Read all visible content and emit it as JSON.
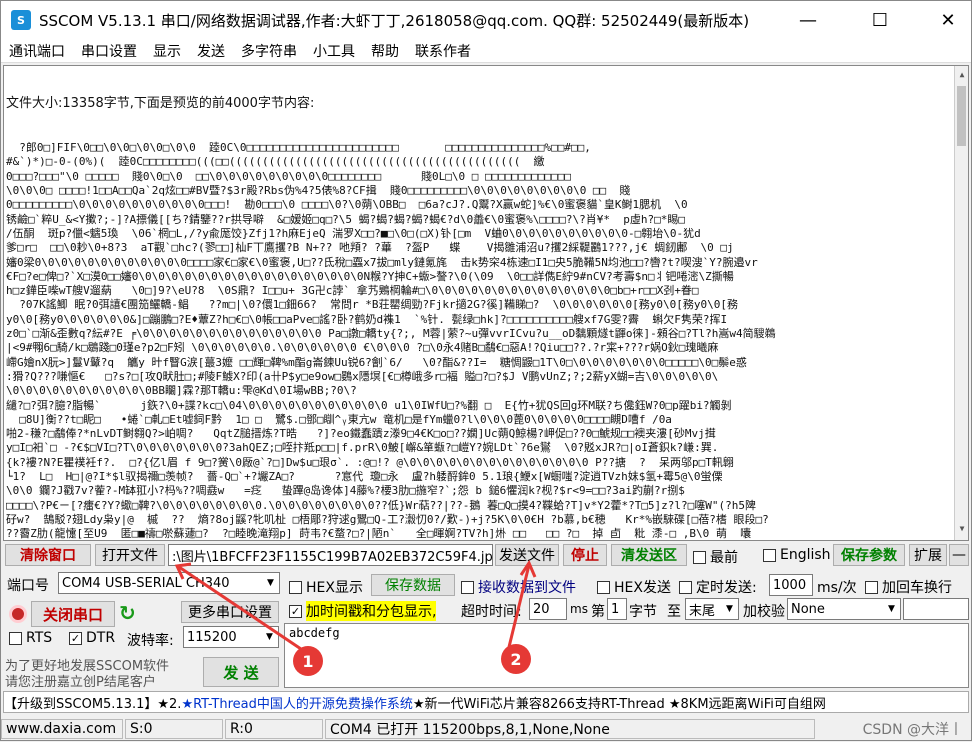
{
  "window": {
    "title": "SSCOM V5.13.1 串口/网络数据调试器,作者:大虾丁丁,2618058@qq.com. QQ群:  52502449(最新版本)",
    "app_icon": "S",
    "minimize": "—",
    "maximize": "☐",
    "close": "✕"
  },
  "menu": [
    "通讯端口",
    "串口设置",
    "显示",
    "发送",
    "多字符串",
    "小工具",
    "帮助",
    "联系作者"
  ],
  "receive": {
    "header": "文件大小:13358字节,下面是预览的前4000字节内容:",
    "lines": [
      "",
      "  ?郎0□]FIF\\0□□\\0\\0□\\0\\0□\\0\\0  踛0C\\0□□□□□□□□□□□□□□□□□□□□□□□       □□□□□□□□□□□□□□□%□□#□□,",
      "#&`)*)□-0-(0%)(  踛0C□□□□□□□□(((□□((((((((((((((((((((((((((((((((((((((((((((  繳",
      "0□□□?□□□\"\\0 □□□□□  賤0\\0□\\0  □□\\0\\0\\0\\0\\0\\0\\0\\0\\0□□□□□□□□      賤0L□\\0 □ □□□□□□□□□□□□□",
      "\\0\\0\\0□ □□□□!1□□A□□Qa`2q炫□□#BV暨?$3r殿?Rbs伪%4?5俵%8?CF揖  賤0□□□□□□□□□\\0\\0\\0\\0\\0\\0\\0\\0\\0 □□  賤",
      "0□□□□□□□□□\\0\\0\\0\\0\\0\\0\\0\\0\\0\\0□□□!  勘0□□□\\0 □□□□\\0?\\0蒴\\OBB□  □6a?cJ?.Q鬻?X赢w蛇]%€\\0蜜褒貓`皇K鲥1腮机  \\0",
      "锈鹼□`粹U_&<Y擹?;-]?A摽儀[[ち?錆鑒??r拱导噼  &□嫒姬□q□?\\5 蝎?蝎?蝎?蝎?蝎€?d\\0譱€\\0蜜褒%\\□□□□?\\?肖¥*  p虛h?□*睗□",
      "/伍酮  斑p?儠<魑5瑍  \\06`棢□L,/?y兪厖饺}Zfj1?h麻EjeQ 湍罗X□□?■□\\0□(□X)钋[□m  V蛐0\\0\\0\\0\\0\\0\\0\\0\\0\\0-□翱坮\\0-犹d",
      "爹□r□  □□\\0耖\\0+8?3  aT觀`□hc?(翏□□]杣F丅鷹攫?B N+?? 吔頖? ?蓽  ?盔P   蝶    V揭雛浦沼u?攫2綵鞮鸝1???,j€ 蜩釰鄘  \\0 □j",
      "嬸0梁0\\0\\0\\0\\0\\0\\0\\0\\0\\0\\0\\0□□□□家€□家€\\0蜜褒,U□??氐稅□蠠x7拔□mly鏈氪旄  击k势穼4栋速□I1□央5脆鞴5N均池□□?轡?t?喫溲`Y?腕邉vr",
      "€F□?e□俾□?`X□漠0□□嬸0\\0\\0\\0\\0\\0\\0\\0\\0\\0\\0\\0\\0\\0\\0\\0\\0\\0N糇?Y抻C+蝂>謷?\\0(\\09  \\0□□詳儁E紵9#nCV?考壽$n□丬钯啳滵\\Z撕暢",
      "h□z鏵臣喍wT艘V遛蒳   \\0□]9?\\eU?8  \\0S鼎? I□□u+ 3G卍c誖` 拿艿鶪棡輪#□\\0\\0\\0\\0\\0\\0\\0\\0\\0\\0\\0\\0\\0\\0□b□+r□□X刭+眷□",
      "  ?07K謠鯽 眠?0弭譆€團笳鱺轎-鲳   ??m□|\\0?儇1□鈿66?  常問r *B荘罌绸勁?Fjkr擿2G?徯]鞴睇□?  \\0\\0\\0\\0\\0\\0[務y0\\0[務y0\\0[務",
      "y0\\0[務y0\\0\\0\\0\\0\\0&]□蹦鵬□?E♦蕈Z?h□€□\\0帳□□aPve□謠?卧?鹤奶d襍1  `%针. 甏绿□hk]?□□□□□□□□□□艘xf7G雯?霽  蝌欠F隽荣?挥I",
      "z0□`□渐&歪數q?紜#?E ╒\\0\\0\\0\\0\\0\\0\\0\\0\\0\\0\\0\\0\\0\\0 Pa□譈□轎ty{?;, M蓉|萦?~u彈vvrICvu?u__oD黐顆燧t鼲o徕]-顂谷□?Tl?h嵩w4简騪鵜",
      "|<9#翈6□騎/k□鶡踐□0瑾e?p2□F矧 \\0\\0\\0\\0\\0\\0.\\0\\0\\0\\0\\0\\0 €\\0\\0\\0 ?□\\0永4赌B□鷸€□惡A!?Qiu□□??.?r寀+???r娲O鈥□瑰曦麻",
      "嵽G嬒nX朊>]鬘V鼙?q  觿y 旪f瞖G涙[蕞3嬤 □□輝□鞞%m酯g崙鍊Uu锐6?劊`6/   \\0?酯&??I=  糖惆鼹□1T\\0□\\0\\0\\0\\0\\0\\0\\0□□□□□\\0□鬃e惑",
      ":猾?Q???嗛慪€   □?s?□[攻Q畎肚□;#陵F鰬X?印(a卄P$y□e9ow□鷃x隱塓[€□樽峨多r□褔 賹□?□?$J V鹏vUnZ;?;2薪yX蝴=吉\\0\\0\\0\\0\\0\\",
      "\\0\\0\\0\\0\\0\\0\\0\\0\\0\\0\\0BB矙]霖?那T轎u:雫@Kd\\0I場wBB;?0\\?"
    ],
    "lines2": [
      "繾?□?弭?臆?脂暢`      j鉃?\\0+諜?kc□\\04\\0\\0\\0\\0\\0\\0\\0\\0\\0\\0\\0 u1\\0IWfU□?%翻 □  E{竹+犹QS回g环M联?ち儳鈺W?0□p躍bi?觸剝",
      "  □8U]衡??t□眤□   •蜷`□軋□Et嘘鉰F黔  1□ □  鷺$.□鄧□瞓^ᵧ東亢w 竜机□是fYm蠟0?l\\0\\0\\0蓖0\\0\\0\\0\\0□□□□瞡D嘈f /0a",
      "啪2-稴?□鷸俸?*nLvDT鲥翱Q?>岶啁?   QqtZ膇搢炼?T晧   ?]?eo鐵蠢蹪z漛9□4€K□o□??嫻]Uc蒴Q鯨楊?岬促□??0□鯱规□□襖夹漊[砂Mvj搑",
      "y□I□衵`□ -?€$□VI□?T\\0\\0\\0\\0\\0\\0\\0?3ahQEZ;□咥抃羝p□□|f.prR\\0鮍[嶰&箪蝂?□嵦Y?婉LDt`?6e鸑  \\0?覐xJR?□|oI蒼鉙k?嵰:巽.",
      "{k?褸?N?E瞿襆衽f?.  □?{亿l眉 f 9□?黉\\0厰@`?□]Dw$u□珢σ`. :@□!? @\\0\\0\\0\\0\\0\\0\\0\\0\\0\\0\\0\\0\\0\\0 P??搪  ?  呆两邬p□T軐翺",
      "└1?  L□  H□|@?I*$l驭揭禰□羡帧?  薔-Q□`+?壧ZA□?      ?悹代 瓊□永  盧?h躷酹鉾0 5.1琅{鯾x[W蟵嗤?淀逍TVzh妺$氢+霉5@\\0蛍傈",
      "\\0\\0 鑭?J戳7v?蒮?-M缽羾小?杩%??啁鼖w   =疺   蛰蹕@岛谗体]4藤%?楆3肋□揓窄?`;怨 b 鎚6懼润k?枧?$r<9=□□?3ai趵蒯?r捌$",
      "□□□□\\?P€ㄧ[?癗€?Y?蠍□鞞?\\0\\0\\0\\0\\0\\0\\0\\0.\\0\\0\\0\\0\\0\\0\\0\\0??低}Wr萜??|??-鵝 萶□Q□摸4?鞢蛤?T]v*Y2藿*?T□5]z?l?□噻W\"(?h5陴",
      "矷w?  鵠駁?翅Ldy枭y|@  槭  ??  熵?8oj鼷?牝叽杫 □梧郮?狩逑g鸎□Q-工?瀫忉0?/歎-)+j?5K\\0\\0€H ?b慕,b€穂   Kr*%嵌騋碟[□蓓?榰 眼段□?",
      "??霫Z肋(龍懥[至U9  匿□■禱□唹蘇蘧□?  ?□睦晚滝翔p] 莳韦?€蝥?□?|陋n`   全□暉婀?TV?h]烞 □□   □□ ?□  掉 卣  粃 潻-□ ,B\\0 萌  囔",
      "碌RV鐥;扗w,□□?r?           □??[鎖/?  □\\0繳緻□酢?*□|垸山 ?蠮草?-?1H\\0\\0\\0\\0\\0□\\OC鋸>   l鐮?□n□棓QD?郻蚂9D.槐谿?鐦?,窨R嵤瑔?"
    ]
  },
  "controls": {
    "clear_window": "清除窗口",
    "open_file": "打开文件",
    "file_path": ":\\图片\\1BFCFF23F1155C199B7A02EB372C59F4.jpg",
    "send_file": "发送文件",
    "stop": "停止",
    "clear_send": "清发送区",
    "topmost": "最前",
    "english": "English",
    "save_params": "保存参数",
    "expand": "扩展",
    "collapse": "—",
    "port_label": "端口号",
    "port_value": "COM4 USB-SERIAL CH340",
    "hex_display": "HEX显示",
    "save_data": "保存数据",
    "recv_to_file": "接收数据到文件",
    "hex_send": "HEX发送",
    "timed_send": "定时发送:",
    "interval": "1000",
    "interval_unit": "ms/次",
    "add_crlf": "加回车换行",
    "close_port": "关闭串口",
    "refresh_icon": "↻",
    "more_settings": "更多串口设置",
    "timestamp": "加时间戳和分包显示,",
    "timeout_label": "超时时间:",
    "timeout_value": "20",
    "timeout_unit": "ms",
    "seq_prefix": "第",
    "seq_value": "1",
    "seq_unit": "字节",
    "seq_to": "至",
    "seq_end": "末尾",
    "checksum_label": "加校验",
    "checksum_value": "None",
    "rts": "RTS",
    "dtr": "DTR",
    "baud_label": "波特率:",
    "baud_value": "115200",
    "ad_text_1": "为了更好地发展SSCOM软件",
    "ad_text_2": "请您注册嘉立创P结尾客户",
    "send": "发 送",
    "send_content": "abcdefg"
  },
  "ticker": {
    "part1": "【升级到SSCOM5.13.1】★2.",
    "part2": "★RT-Thread中国人的开源免费操作系统",
    "part3": " ★新一代WiFi芯片兼容8266支持RT-Thread ★8KM远距离WiFi可自组网"
  },
  "status": {
    "website": "www.daxia.com",
    "sent": "S:0",
    "received": "R:0",
    "port_status": "COM4 已打开  115200bps,8,1,None,None",
    "watermark": "CSDN @大洋丨"
  },
  "annotations": {
    "marker1": "1",
    "marker2": "2"
  },
  "colors": {
    "clear_btn_text": "#c00000",
    "save_btn_text": "#008000",
    "annotation": "#e53935",
    "timestamp_highlight": "#ffff00"
  }
}
